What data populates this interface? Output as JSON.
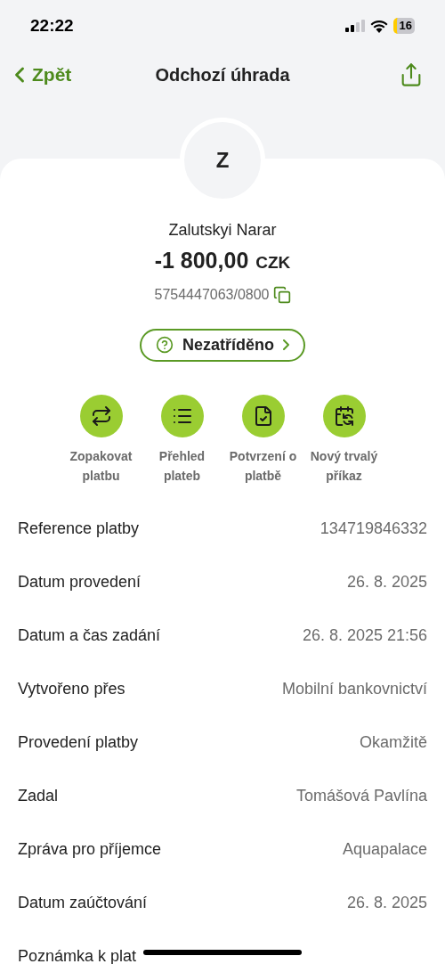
{
  "status_bar": {
    "time": "22:22",
    "battery": "16"
  },
  "nav": {
    "back": "Zpět",
    "title": "Odchozí úhrada"
  },
  "counterparty": {
    "initial": "Z",
    "name": "Zalutskyi Narar",
    "amount": "-1 800,00",
    "currency": "CZK",
    "account": "5754447063/0800"
  },
  "category": {
    "label": "Nezatříděno"
  },
  "actions": [
    {
      "kind": "repeat",
      "label": "Zopakovat platbu"
    },
    {
      "kind": "list",
      "label": "Přehled plateb"
    },
    {
      "kind": "confirm",
      "label": "Potvrzení o platbě"
    },
    {
      "kind": "standing",
      "label": "Nový trvalý příkaz"
    }
  ],
  "details": [
    {
      "label": "Reference platby",
      "value": "134719846332"
    },
    {
      "label": "Datum provedení",
      "value": "26. 8. 2025"
    },
    {
      "label": "Datum a čas zadání",
      "value": "26. 8. 2025 21:56"
    },
    {
      "label": "Vytvořeno přes",
      "value": "Mobilní bankovnictví"
    },
    {
      "label": "Provedení platby",
      "value": "Okamžitě"
    },
    {
      "label": "Zadal",
      "value": "Tomášová Pavlína"
    },
    {
      "label": "Zpráva pro příjemce",
      "value": "Aquapalace"
    },
    {
      "label": "Datum zaúčtování",
      "value": "26. 8. 2025"
    },
    {
      "label": "Poznámka k plat"
    }
  ]
}
